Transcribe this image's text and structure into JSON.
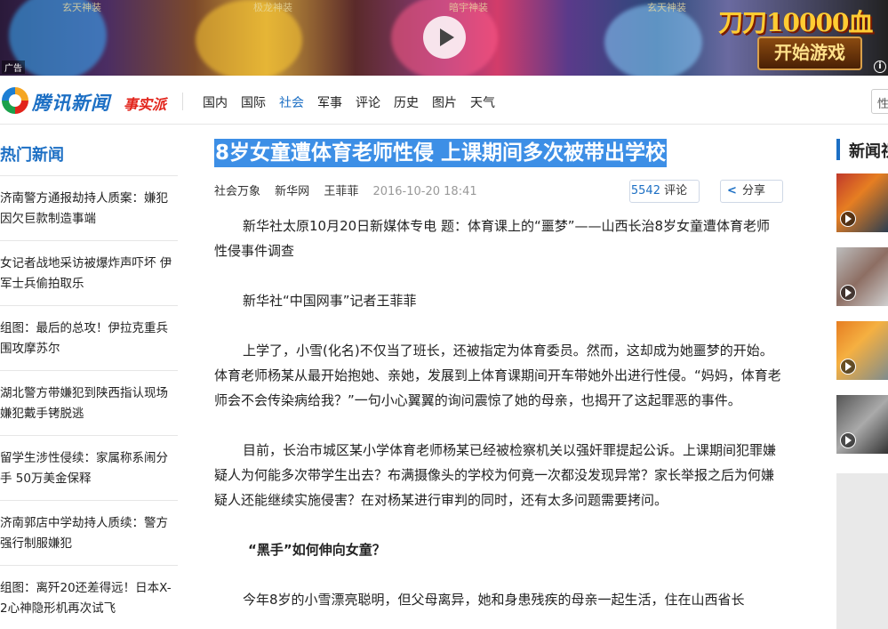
{
  "ad": {
    "tag": "广告",
    "promo_text": "刀刀10000血",
    "start_label": "开始游戏",
    "labels": [
      "玄天神装",
      "极龙神装",
      "暗宇神装",
      "玄天神装"
    ]
  },
  "nav": {
    "brand": "腾讯新闻",
    "brand_sub": "事实派",
    "items": [
      "国内",
      "国际",
      "社会",
      "军事",
      "评论",
      "历史",
      "图片",
      "天气"
    ],
    "active": "社会",
    "search_text": "性"
  },
  "sidebar": {
    "heading": "热门新闻",
    "items": [
      "济南警方通报劫持人质案：嫌犯因欠巨款制造事端",
      "女记者战地采访被爆炸声吓坏 伊军士兵偷拍取乐",
      "组图：最后的总攻！伊拉克重兵围攻摩苏尔",
      "湖北警方带嫌犯到陕西指认现场 嫌犯戴手铐脱逃",
      "留学生涉性侵续：家属称系闹分手 50万美金保释",
      "济南郭店中学劫持人质续：警方强行制服嫌犯",
      "组图：离歼20还差得远！日本X-2心神隐形机再次试飞"
    ]
  },
  "article": {
    "title": "8岁女童遭体育老师性侵 上课期间多次被带出学校",
    "meta": {
      "category": "社会万象",
      "source": "新华网",
      "author": "王菲菲",
      "date": "2016-10-20 18:41",
      "comment_count": "5542",
      "comment_label": "评论",
      "share_label": "分享"
    },
    "paragraphs": [
      "新华社太原10月20日新媒体专电 题：体育课上的“噩梦”——山西长治8岁女童遭体育老师性侵事件调查",
      "新华社“中国网事”记者王菲菲",
      "上学了，小雪(化名)不仅当了班长，还被指定为体育委员。然而，这却成为她噩梦的开始。体育老师杨某从最开始抱她、亲她，发展到上体育课期间开车带她外出进行性侵。“妈妈，体育老师会不会传染病给我？”一句小心翼翼的询问震惊了她的母亲，也揭开了这起罪恶的事件。",
      "目前，长治市城区某小学体育老师杨某已经被检察机关以强奸罪提起公诉。上课期间犯罪嫌疑人为何能多次带学生出去？布满摄像头的学校为何竟一次都没发现异常？家长举报之后为何嫌疑人还能继续实施侵害？在对杨某进行审判的同时，还有太多问题需要拷问。"
    ],
    "subheading": "“黑手”如何伸向女童？",
    "last_paragraph": "今年8岁的小雪漂亮聪明，但父母离异，她和身患残疾的母亲一起生活，住在山西省长"
  },
  "rail": {
    "heading": "新闻视频"
  },
  "colors": {
    "brand_blue": "#1c6fc4",
    "highlight": "#3d8fe6",
    "brand_red": "#e2231a"
  }
}
